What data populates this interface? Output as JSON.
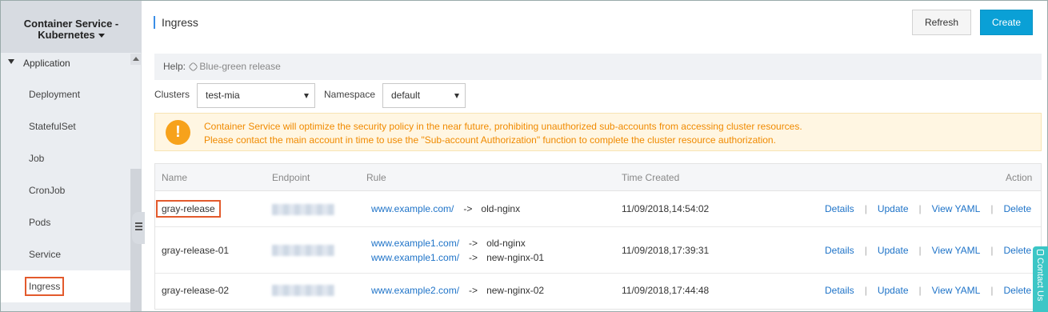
{
  "sidebar": {
    "header_line1": "Container Service -",
    "header_line2": "Kubernetes",
    "group": "Application",
    "items": [
      {
        "label": "Deployment"
      },
      {
        "label": "StatefulSet"
      },
      {
        "label": "Job"
      },
      {
        "label": "CronJob"
      },
      {
        "label": "Pods"
      },
      {
        "label": "Service"
      },
      {
        "label": "Ingress"
      }
    ]
  },
  "page": {
    "title": "Ingress",
    "refresh_label": "Refresh",
    "create_label": "Create"
  },
  "help": {
    "label": "Help:",
    "link": "Blue-green release"
  },
  "filters": {
    "clusters_label": "Clusters",
    "clusters_value": "test-mia",
    "namespace_label": "Namespace",
    "namespace_value": "default"
  },
  "notice": {
    "line1": "Container Service will optimize the security policy in the near future, prohibiting unauthorized sub-accounts from accessing cluster resources.",
    "line2": "Please contact the main account in time to use the \"Sub-account Authorization\" function to complete the cluster resource authorization."
  },
  "table": {
    "columns": [
      "Name",
      "Endpoint",
      "Rule",
      "Time Created",
      "Action"
    ],
    "arrow": "->",
    "actions": [
      "Details",
      "Update",
      "View YAML",
      "Delete"
    ],
    "rows": [
      {
        "name": "gray-release",
        "rules": [
          {
            "host": "www.example.com/",
            "target": "old-nginx"
          }
        ],
        "time": "11/09/2018,14:54:02"
      },
      {
        "name": "gray-release-01",
        "rules": [
          {
            "host": "www.example1.com/",
            "target": "old-nginx"
          },
          {
            "host": "www.example1.com/",
            "target": "new-nginx-01"
          }
        ],
        "time": "11/09/2018,17:39:31"
      },
      {
        "name": "gray-release-02",
        "rules": [
          {
            "host": "www.example2.com/",
            "target": "new-nginx-02"
          }
        ],
        "time": "11/09/2018,17:44:48"
      }
    ]
  },
  "contact": {
    "label": "Contact Us"
  },
  "colors": {
    "primary_button": "#0aa0d6",
    "link": "#1e73c8",
    "warning": "#f08a00",
    "highlight_box": "#e35a2c"
  }
}
